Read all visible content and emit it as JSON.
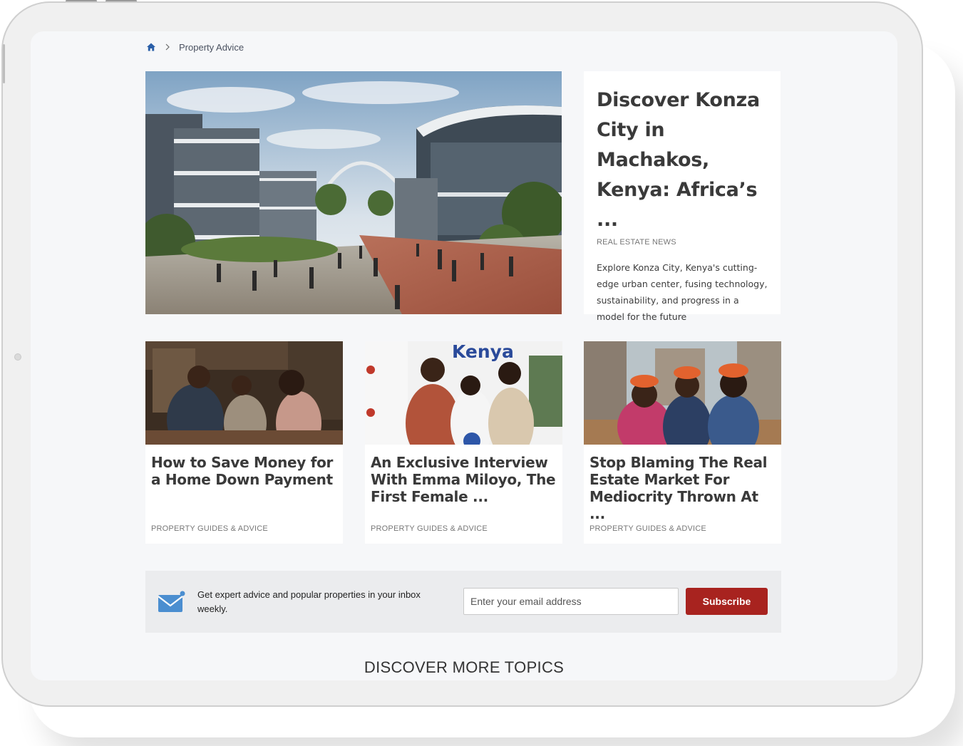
{
  "breadcrumb": {
    "home_icon": "home-icon",
    "separator_icon": "chevron-right-icon",
    "current": "Property Advice"
  },
  "hero": {
    "title": "Discover Konza City in Machakos, Kenya: Africa’s ...",
    "category": "REAL ESTATE NEWS",
    "description": "Explore Konza City, Kenya's cutting-edge urban center, fusing technology, sustainability, and progress in a model for the future"
  },
  "cards": [
    {
      "title": "How to Save Money for a Home Down Payment",
      "category": "PROPERTY GUIDES & ADVICE"
    },
    {
      "title": "An Exclusive Interview With Emma Miloyo, The First Female ...",
      "category": "PROPERTY GUIDES & ADVICE",
      "image_text": "Kenya"
    },
    {
      "title": "Stop Blaming The Real Estate Market For Mediocrity Thrown At ...",
      "category": "PROPERTY GUIDES & ADVICE"
    }
  ],
  "newsletter": {
    "icon": "mail-icon",
    "text": "Get expert advice and popular properties in your inbox weekly.",
    "placeholder": "Enter your email address",
    "button": "Subscribe"
  },
  "discover": "DISCOVER MORE TOPICS",
  "colors": {
    "accent": "#a8231f",
    "link_blue": "#2a5fa8",
    "screen_bg": "#f6f7f9"
  }
}
